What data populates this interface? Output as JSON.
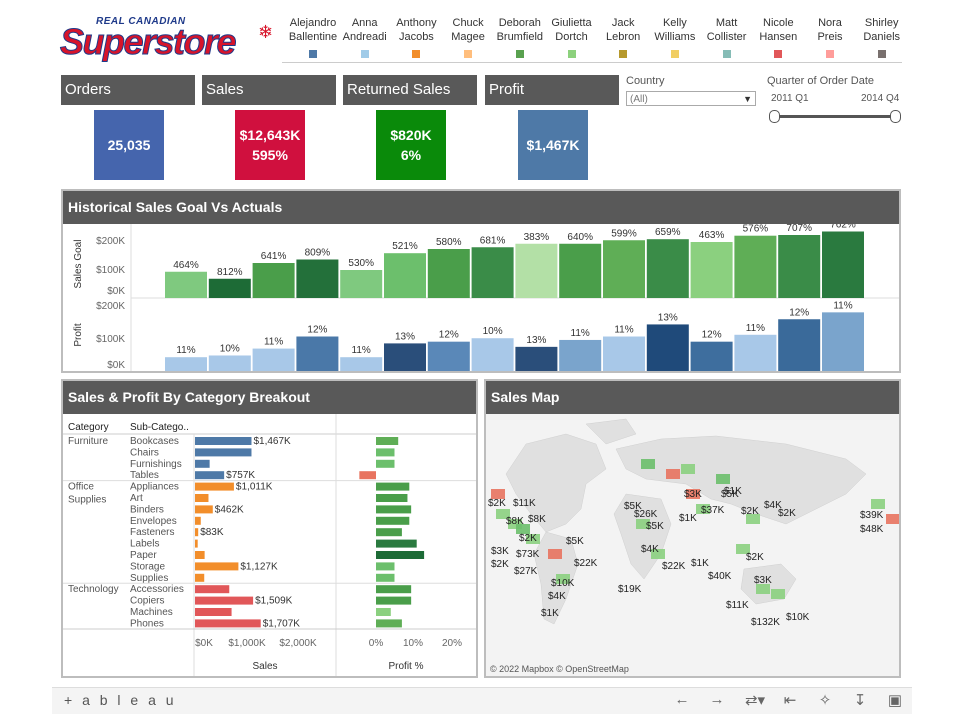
{
  "logo": {
    "top": "REAL CANADIAN",
    "main": "Superstore"
  },
  "legend": [
    {
      "name": "Alejandro\nBallentine",
      "color": "#4e79a7"
    },
    {
      "name": "Anna\nAndreadi",
      "color": "#a0cbe8"
    },
    {
      "name": "Anthony\nJacobs",
      "color": "#f28e2b"
    },
    {
      "name": "Chuck\nMagee",
      "color": "#ffbe7d"
    },
    {
      "name": "Deborah\nBrumfield",
      "color": "#59a14f"
    },
    {
      "name": "Giulietta\nDortch",
      "color": "#8cd17d"
    },
    {
      "name": "Jack\nLebron",
      "color": "#b6992d"
    },
    {
      "name": "Kelly\nWilliams",
      "color": "#f1ce63"
    },
    {
      "name": "Matt\nCollister",
      "color": "#86bcb6"
    },
    {
      "name": "Nicole\nHansen",
      "color": "#e15759"
    },
    {
      "name": "Nora\nPreis",
      "color": "#ff9d9a"
    },
    {
      "name": "Shirley\nDaniels",
      "color": "#79706e"
    }
  ],
  "kpis": [
    {
      "title": "Orders",
      "line1": "25,035",
      "line2": "",
      "color": "#4565ad"
    },
    {
      "title": "Sales",
      "line1": "$12,643K",
      "line2": "595%",
      "color": "#d0103e"
    },
    {
      "title": "Returned Sales",
      "line1": "$820K",
      "line2": "6%",
      "color": "#0a8a0a"
    },
    {
      "title": "Profit",
      "line1": "$1,467K",
      "line2": "",
      "color": "#4e79a7"
    }
  ],
  "filters": {
    "country_label": "Country",
    "country_value": "(All)",
    "quarter_label": "Quarter of Order Date",
    "quarter_min": "2011 Q1",
    "quarter_max": "2014 Q4"
  },
  "historical": {
    "title": "Historical Sales Goal Vs Actuals",
    "goal_axis_label": "Sales Goal",
    "goal_ticks": [
      "$200K",
      "$100K",
      "$0K"
    ],
    "profit_axis_label": "Profit",
    "profit_ticks": [
      "$200K",
      "$100K",
      "$0K"
    ]
  },
  "chart_data": [
    {
      "type": "bar",
      "title": "Historical Sales Goal Vs Actuals",
      "ylabel": "Sales Goal",
      "ylim": [
        0,
        200000
      ],
      "values": [
        75000,
        55000,
        100000,
        110000,
        80000,
        128000,
        140000,
        145000,
        155000,
        155000,
        165000,
        168000,
        160000,
        178000,
        180000,
        190000
      ],
      "labels": [
        "464%",
        "812%",
        "641%",
        "809%",
        "530%",
        "521%",
        "580%",
        "681%",
        "383%",
        "640%",
        "599%",
        "659%",
        "463%",
        "576%",
        "707%",
        "762%"
      ],
      "colors": [
        "#7fc97f",
        "#1d6b36",
        "#4a9e4a",
        "#23703a",
        "#7fc97f",
        "#6cbf6c",
        "#4a9e4a",
        "#3a8c48",
        "#b3e0a6",
        "#4a9e4a",
        "#5fae56",
        "#3a8c48",
        "#8bd07f",
        "#5fae56",
        "#3a8c48",
        "#2a7a3f"
      ]
    },
    {
      "type": "bar",
      "ylabel": "Profit",
      "ylim": [
        0,
        200000
      ],
      "values": [
        40000,
        45000,
        65000,
        100000,
        40000,
        80000,
        85000,
        95000,
        70000,
        90000,
        100000,
        135000,
        85000,
        105000,
        150000,
        170000
      ],
      "labels": [
        "11%",
        "10%",
        "11%",
        "12%",
        "11%",
        "13%",
        "12%",
        "10%",
        "13%",
        "11%",
        "11%",
        "13%",
        "12%",
        "11%",
        "12%",
        "11%"
      ],
      "colors": [
        "#a8c8e8",
        "#a8c8e8",
        "#a8c8e8",
        "#4a78a8",
        "#a8c8e8",
        "#2a4e7a",
        "#5a88b8",
        "#a8c8e8",
        "#2a4e7a",
        "#7aa4cc",
        "#a8c8e8",
        "#1f4a7a",
        "#3e6e9e",
        "#a8c8e8",
        "#3a6a9a",
        "#7aa4cc"
      ]
    },
    {
      "type": "bar",
      "title": "Sales & Profit By Category Breakout",
      "xlabel": "Sales",
      "xlim": [
        0,
        2000
      ],
      "x_ticks": [
        "$0K",
        "$1,000K",
        "$2,000K"
      ],
      "columns": [
        "Category",
        "Sub-Catego.."
      ],
      "groups": [
        {
          "category": "Furniture",
          "items": [
            {
              "name": "Bookcases",
              "sales": 1467,
              "label": "$1,467K",
              "profit_pct": 6.0,
              "sales_color": "#4e79a7",
              "profit_color": "#5fae56"
            },
            {
              "name": "Chairs",
              "sales": 1467,
              "label": "",
              "profit_pct": 5.0,
              "sales_color": "#4e79a7",
              "profit_color": "#6cbf6c"
            },
            {
              "name": "Furnishings",
              "sales": 380,
              "label": "",
              "profit_pct": 5.0,
              "sales_color": "#4e79a7",
              "profit_color": "#6cbf6c"
            },
            {
              "name": "Tables",
              "sales": 757,
              "label": "$757K",
              "profit_pct": -4.5,
              "sales_color": "#4e79a7",
              "profit_color": "#e8735f"
            }
          ]
        },
        {
          "category": "Office Supplies",
          "items": [
            {
              "name": "Appliances",
              "sales": 1011,
              "label": "$1,011K",
              "profit_pct": 9.0,
              "sales_color": "#f28e2b",
              "profit_color": "#4a9e4a"
            },
            {
              "name": "Art",
              "sales": 350,
              "label": "",
              "profit_pct": 8.5,
              "sales_color": "#f28e2b",
              "profit_color": "#4a9e4a"
            },
            {
              "name": "Binders",
              "sales": 462,
              "label": "$462K",
              "profit_pct": 9.5,
              "sales_color": "#f28e2b",
              "profit_color": "#4a9e4a"
            },
            {
              "name": "Envelopes",
              "sales": 150,
              "label": "",
              "profit_pct": 9.0,
              "sales_color": "#f28e2b",
              "profit_color": "#4a9e4a"
            },
            {
              "name": "Fasteners",
              "sales": 83,
              "label": "$83K",
              "profit_pct": 7.0,
              "sales_color": "#f28e2b",
              "profit_color": "#4a9e4a"
            },
            {
              "name": "Labels",
              "sales": 70,
              "label": "",
              "profit_pct": 11.0,
              "sales_color": "#f28e2b",
              "profit_color": "#2a7a3f"
            },
            {
              "name": "Paper",
              "sales": 250,
              "label": "",
              "profit_pct": 13.0,
              "sales_color": "#f28e2b",
              "profit_color": "#1d6b36"
            },
            {
              "name": "Storage",
              "sales": 1127,
              "label": "$1,127K",
              "profit_pct": 5.0,
              "sales_color": "#f28e2b",
              "profit_color": "#6cbf6c"
            },
            {
              "name": "Supplies",
              "sales": 240,
              "label": "",
              "profit_pct": 5.0,
              "sales_color": "#f28e2b",
              "profit_color": "#6cbf6c"
            }
          ]
        },
        {
          "category": "Technology",
          "items": [
            {
              "name": "Accessories",
              "sales": 890,
              "label": "",
              "profit_pct": 9.5,
              "sales_color": "#e15759",
              "profit_color": "#4a9e4a"
            },
            {
              "name": "Copiers",
              "sales": 1509,
              "label": "$1,509K",
              "profit_pct": 9.5,
              "sales_color": "#e15759",
              "profit_color": "#4a9e4a"
            },
            {
              "name": "Machines",
              "sales": 950,
              "label": "",
              "profit_pct": 4.0,
              "sales_color": "#e15759",
              "profit_color": "#8bd07f"
            },
            {
              "name": "Phones",
              "sales": 1707,
              "label": "$1,707K",
              "profit_pct": 7.0,
              "sales_color": "#e15759",
              "profit_color": "#5fae56"
            }
          ]
        }
      ],
      "profit_xlabel": "Profit %",
      "profit_xlim": [
        -5,
        22
      ],
      "profit_ticks": [
        "0%",
        "10%",
        "20%"
      ]
    }
  ],
  "map": {
    "title": "Sales Map",
    "attribution": "© 2022 Mapbox  © OpenStreetMap",
    "labels": [
      "$2K",
      "$11K",
      "$8K",
      "$8K",
      "$2K",
      "$3K",
      "$2K",
      "$22K",
      "$73K",
      "$27K",
      "$10K",
      "$4K",
      "$1K",
      "$48K",
      "$5K",
      "$26K",
      "$5K",
      "$19K",
      "$5K",
      "$22K",
      "$1K",
      "$2K",
      "$1K",
      "$3K",
      "$37K",
      "$2K",
      "$2K",
      "$1K",
      "$4K",
      "$4K",
      "$40K",
      "$3K",
      "$11K",
      "$10K",
      "$132K",
      "$39K",
      "$48K",
      "$5K"
    ]
  },
  "footer": {
    "brand": "+ a b l e a u"
  }
}
